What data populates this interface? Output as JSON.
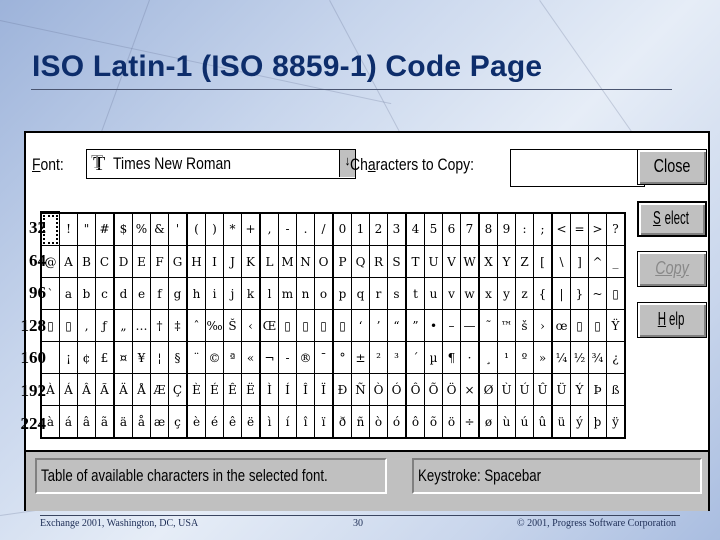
{
  "slide": {
    "title": "ISO Latin-1 (ISO 8859-1) Code Page",
    "footer_left": "Exchange 2001, Washington, DC, USA",
    "page_number": "30",
    "footer_right": "© 2001, Progress Software Corporation"
  },
  "dialog": {
    "font_label_accel": "F",
    "font_label_rest": "ont:",
    "font_value": "Times New Roman",
    "font_icon": "truetype-icon",
    "dropdown_glyph": "↓",
    "chars_label_pre": "Ch",
    "chars_label_accel": "a",
    "chars_label_post": "racters to Copy:",
    "chars_to_copy_value": "",
    "buttons": {
      "close": "Close",
      "select_accel": "S",
      "select_rest": "elect",
      "copy": "Copy",
      "copy_enabled": false,
      "help_accel": "H",
      "help_rest": "elp"
    },
    "selected_char_code": 32,
    "status_description": "Table of available characters in the selected font.",
    "status_keystroke": "Keystroke: Spacebar"
  },
  "grid": {
    "row_labels": [
      "32",
      "64",
      "96",
      "128",
      "160",
      "192",
      "224"
    ],
    "rows": [
      [
        " ",
        "!",
        "\"",
        "#",
        "$",
        "%",
        "&",
        "'",
        "(",
        ")",
        "*",
        "+",
        ",",
        "-",
        ".",
        "/",
        "0",
        "1",
        "2",
        "3",
        "4",
        "5",
        "6",
        "7",
        "8",
        "9",
        ":",
        ";",
        "<",
        "=",
        ">",
        "?"
      ],
      [
        "@",
        "A",
        "B",
        "C",
        "D",
        "E",
        "F",
        "G",
        "H",
        "I",
        "J",
        "K",
        "L",
        "M",
        "N",
        "O",
        "P",
        "Q",
        "R",
        "S",
        "T",
        "U",
        "V",
        "W",
        "X",
        "Y",
        "Z",
        "[",
        "\\",
        "]",
        "^",
        "_"
      ],
      [
        "`",
        "a",
        "b",
        "c",
        "d",
        "e",
        "f",
        "g",
        "h",
        "i",
        "j",
        "k",
        "l",
        "m",
        "n",
        "o",
        "p",
        "q",
        "r",
        "s",
        "t",
        "u",
        "v",
        "w",
        "x",
        "y",
        "z",
        "{",
        "|",
        "}",
        "~",
        "▯"
      ],
      [
        "▯",
        "▯",
        "‚",
        "ƒ",
        "„",
        "…",
        "†",
        "‡",
        "ˆ",
        "‰",
        "Š",
        "‹",
        "Œ",
        "▯",
        "▯",
        "▯",
        "▯",
        "‘",
        "’",
        "“",
        "”",
        "•",
        "–",
        "—",
        "˜",
        "™",
        "š",
        "›",
        "œ",
        "▯",
        "▯",
        "Ÿ"
      ],
      [
        " ",
        "¡",
        "¢",
        "£",
        "¤",
        "¥",
        "¦",
        "§",
        "¨",
        "©",
        "ª",
        "«",
        "¬",
        "-",
        "®",
        "¯",
        "°",
        "±",
        "²",
        "³",
        "´",
        "µ",
        "¶",
        "·",
        "¸",
        "¹",
        "º",
        "»",
        "¼",
        "½",
        "¾",
        "¿"
      ],
      [
        "À",
        "Á",
        "Â",
        "Ã",
        "Ä",
        "Å",
        "Æ",
        "Ç",
        "È",
        "É",
        "Ê",
        "Ë",
        "Ì",
        "Í",
        "Î",
        "Ï",
        "Ð",
        "Ñ",
        "Ò",
        "Ó",
        "Ô",
        "Õ",
        "Ö",
        "×",
        "Ø",
        "Ù",
        "Ú",
        "Û",
        "Ü",
        "Ý",
        "Þ",
        "ß"
      ],
      [
        "à",
        "á",
        "â",
        "ã",
        "ä",
        "å",
        "æ",
        "ç",
        "è",
        "é",
        "ê",
        "ë",
        "ì",
        "í",
        "î",
        "ï",
        "ð",
        "ñ",
        "ò",
        "ó",
        "ô",
        "õ",
        "ö",
        "÷",
        "ø",
        "ù",
        "ú",
        "û",
        "ü",
        "ý",
        "þ",
        "ÿ"
      ]
    ]
  }
}
